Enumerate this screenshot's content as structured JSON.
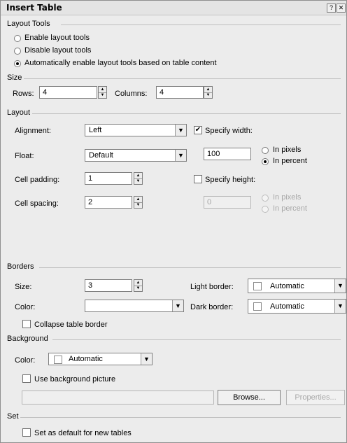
{
  "window": {
    "title": "Insert Table",
    "help_label": "?",
    "close_label": "✕"
  },
  "layout_tools": {
    "section_label": "Layout Tools",
    "options": [
      "Enable layout tools",
      "Disable layout tools",
      "Automatically enable layout tools based on table content"
    ],
    "selected_index": 2
  },
  "size": {
    "section_label": "Size",
    "rows_label": "Rows:",
    "rows_value": "4",
    "columns_label": "Columns:",
    "columns_value": "4"
  },
  "layout": {
    "section_label": "Layout",
    "alignment_label": "Alignment:",
    "alignment_value": "Left",
    "float_label": "Float:",
    "float_value": "Default",
    "cell_padding_label": "Cell padding:",
    "cell_padding_value": "1",
    "cell_spacing_label": "Cell spacing:",
    "cell_spacing_value": "2",
    "specify_width_label": "Specify width:",
    "specify_width_checked": true,
    "width_value": "100",
    "width_unit_pixels": "In pixels",
    "width_unit_percent": "In percent",
    "specify_height_label": "Specify height:",
    "specify_height_checked": false,
    "height_value": "0",
    "height_unit_pixels": "In pixels",
    "height_unit_percent": "In percent"
  },
  "borders": {
    "section_label": "Borders",
    "size_label": "Size:",
    "size_value": "3",
    "color_label": "Color:",
    "color_value": "",
    "light_border_label": "Light border:",
    "light_border_value": "Automatic",
    "dark_border_label": "Dark border:",
    "dark_border_value": "Automatic",
    "collapse_label": "Collapse table border",
    "collapse_checked": false
  },
  "background": {
    "section_label": "Background",
    "color_label": "Color:",
    "color_value": "Automatic",
    "use_picture_label": "Use background picture",
    "use_picture_checked": false,
    "picture_path": "",
    "browse_label": "Browse...",
    "properties_label": "Properties..."
  },
  "set": {
    "section_label": "Set",
    "default_label": "Set as default for new tables",
    "default_checked": false
  },
  "icons": {
    "spin_up": "▲",
    "spin_down": "▼",
    "dropdown": "▼",
    "check": "✔"
  },
  "colors": {
    "dialog_bg": "#ececec",
    "disabled_text": "#a8a8a8",
    "rule": "#bfbfbf"
  }
}
